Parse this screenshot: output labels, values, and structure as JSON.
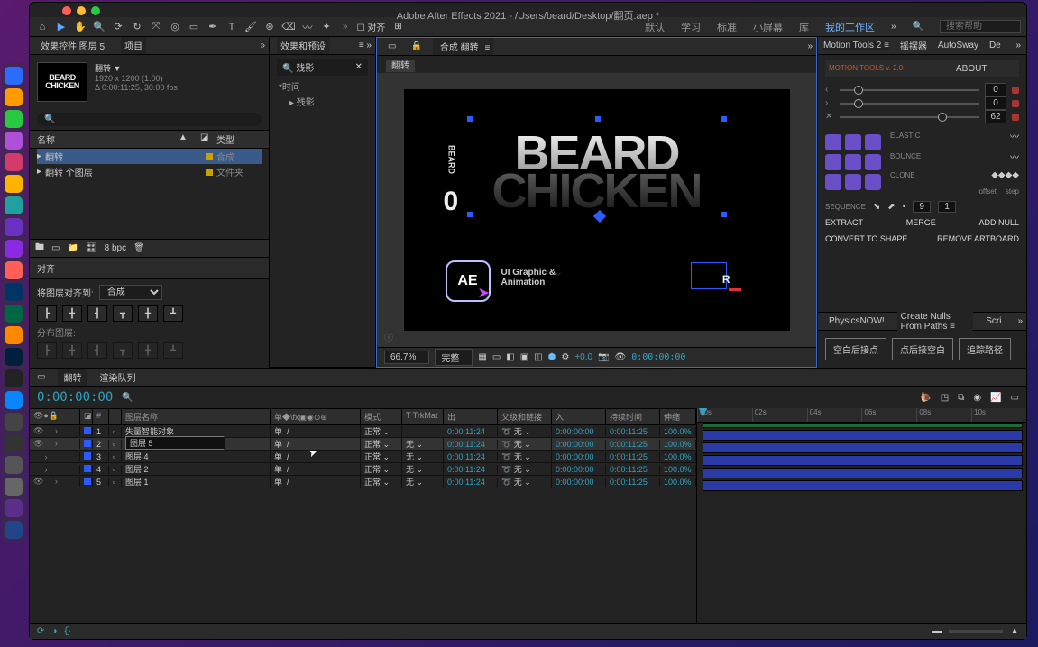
{
  "colors": {
    "red": "#ff5f57",
    "yellow": "#febc2e",
    "green": "#28c840"
  },
  "windowTitle": "Adobe After Effects 2021 - /Users/beard/Desktop/翻页.aep *",
  "toolbar": {
    "icons": [
      "home-icon",
      "selection-icon",
      "hand-icon",
      "zoom-icon",
      "orbit-icon",
      "rotate-icon",
      "unified-camera-icon",
      "panbehind-icon",
      "rect-icon",
      "pen-icon",
      "type-icon",
      "brush-icon",
      "clone-icon",
      "eraser-icon",
      "roto-icon",
      "puppet-icon"
    ],
    "snap_label": "对齐"
  },
  "workspaces": {
    "items": [
      "默认",
      "学习",
      "标准",
      "小屏幕",
      "库"
    ],
    "active": "我的工作区",
    "search_placeholder": "搜索帮助"
  },
  "leftPanel": {
    "tabs": [
      "效果控件 图层 5",
      "项目"
    ],
    "active": "项目",
    "item": {
      "name": "翻转 ▼",
      "res": "1920 x 1200 (1.00)",
      "dur": "Δ 0:00:11:25, 30.00 fps"
    },
    "thumb": "BEARD\nCHICKEN",
    "search": "",
    "cols": {
      "name": "名称",
      "type": "类型"
    },
    "rows": [
      {
        "name": "翻转",
        "type": "合成",
        "color": "#c7a200",
        "sel": true
      },
      {
        "name": "翻转 个图层",
        "type": "文件夹",
        "color": "#c7a200"
      }
    ],
    "footer": {
      "bpc": "8 bpc"
    }
  },
  "alignPanel": {
    "title": "对齐",
    "label": "将图层对齐到:",
    "target": "合成",
    "distribute": "分布图层:"
  },
  "fxPanel": {
    "tab": "效果和预设",
    "search": "残影",
    "groups": [
      "*时间",
      "▸ 残影"
    ]
  },
  "viewer": {
    "compTabLabel": "合成 翻转",
    "compName": "翻转",
    "canvas": {
      "word1": "BEARD",
      "word2": "CHICKEN",
      "vtxt": "BEARD",
      "zero": "0",
      "ae": "AE",
      "subtitle1": "UI Graphic &",
      "subtitle2": "Animation"
    },
    "footer": {
      "zoom": "66.7%",
      "quality": "完整",
      "exposure": "+0.0",
      "time": "0:00:00:00"
    }
  },
  "rightPanel": {
    "tabs": [
      "Motion Tools 2",
      "摇摆器",
      "AutoSway",
      "De"
    ],
    "mt2": {
      "title": "MOTION TOOLS v. 2.0",
      "about": "ABOUT",
      "sliders": [
        {
          "glyph": "‹",
          "pos": 10,
          "val": "0"
        },
        {
          "glyph": "›",
          "pos": 10,
          "val": "0"
        },
        {
          "glyph": "✕",
          "pos": 70,
          "val": "62"
        }
      ],
      "flags": {
        "elastic": "ELASTIC",
        "bounce": "BOUNCE",
        "clone": "CLONE",
        "offset": "offset",
        "step": "step"
      },
      "seq": {
        "label": "SEQUENCE",
        "offset": "9",
        "step": "1"
      },
      "acts": {
        "extract": "EXTRACT",
        "merge": "MERGE",
        "addnull": "ADD NULL"
      },
      "shape": {
        "cts": "CONVERT TO SHAPE",
        "ra": "REMOVE ARTBOARD"
      }
    },
    "tabs2": [
      "PhysicsNOW!",
      "Create Nulls From Paths",
      "Scri"
    ],
    "pills": [
      "空白后接点",
      "点后接空白",
      "追踪路径"
    ]
  },
  "timeline": {
    "tabs": [
      "翻转",
      "渲染队列"
    ],
    "time": "0:00:00:00",
    "cols": {
      "idx": "#",
      "name": "图层名称",
      "mode": "模式",
      "trkmat": "T TrkMat",
      "out": "出",
      "parent": "父级和链接",
      "in": "入",
      "dur": "持续时间",
      "stretch": "伸缩"
    },
    "ruler": [
      "00s",
      "02s",
      "04s",
      "06s",
      "08s",
      "10s"
    ],
    "rows": [
      {
        "i": 1,
        "name": "失量智能对象",
        "mode": "正常",
        "tm": "",
        "out": "0:00:11:24",
        "par": "无",
        "in": "0:00:00:00",
        "dur": "0:00:11:25",
        "str": "100.0%",
        "eye": true
      },
      {
        "i": 2,
        "name": "图层 5",
        "mode": "正常",
        "tm": "无",
        "out": "0:00:11:24",
        "par": "无",
        "in": "0:00:00:00",
        "dur": "0:00:11:25",
        "str": "100.0%",
        "eye": true,
        "sel": true,
        "edit": true
      },
      {
        "i": 3,
        "name": "图层 4",
        "mode": "正常",
        "tm": "无",
        "out": "0:00:11:24",
        "par": "无",
        "in": "0:00:00:00",
        "dur": "0:00:11:25",
        "str": "100.0%"
      },
      {
        "i": 4,
        "name": "图层 2",
        "mode": "正常",
        "tm": "无",
        "out": "0:00:11:24",
        "par": "无",
        "in": "0:00:00:00",
        "dur": "0:00:11:25",
        "str": "100.0%"
      },
      {
        "i": 5,
        "name": "图层 1",
        "mode": "正常",
        "tm": "无",
        "out": "0:00:11:24",
        "par": "无",
        "in": "0:00:00:00",
        "dur": "0:00:11:25",
        "str": "100.0%",
        "eye": true
      }
    ]
  },
  "dock": [
    "#2a6cff",
    "#ff9a00",
    "#28c840",
    "#b04fd8",
    "#d43a6a",
    "#ffb300",
    "#21a0a0",
    "#6a30c0",
    "#8a2be2",
    "#ff5f57",
    "#003366",
    "#006644",
    "#ff8800",
    "#001f3f",
    "#222",
    "#0a84ff",
    "#444",
    "#333",
    "#555",
    "#666",
    "#5b2e8a",
    "#224488"
  ]
}
